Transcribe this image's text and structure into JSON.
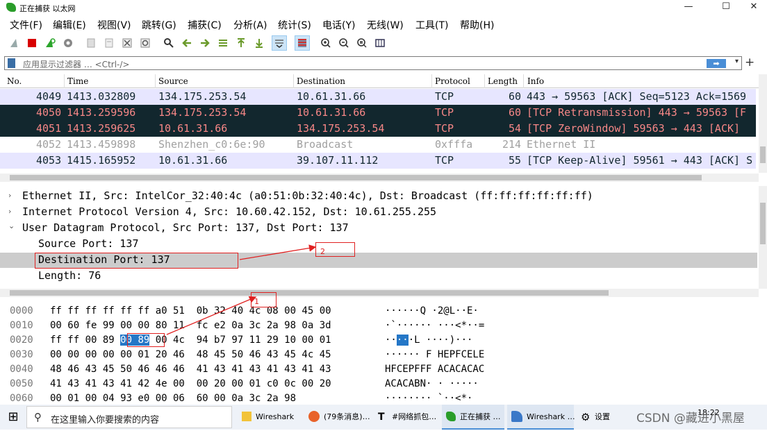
{
  "window": {
    "title": "正在捕获 以太网",
    "min": "—",
    "max": "☐",
    "close": "✕"
  },
  "menu": [
    "文件(F)",
    "编辑(E)",
    "视图(V)",
    "跳转(G)",
    "捕获(C)",
    "分析(A)",
    "统计(S)",
    "电话(Y)",
    "无线(W)",
    "工具(T)",
    "帮助(H)"
  ],
  "toolbar_icons": [
    "shark-fin-icon",
    "stop-icon",
    "restart-icon",
    "options-gear-icon",
    "open-icon",
    "save-icon",
    "close-file-icon",
    "reload-icon",
    "find-icon",
    "back-icon",
    "forward-icon",
    "goto-icon",
    "first-icon",
    "last-icon",
    "autoscroll-icon",
    "colorize-icon",
    "zoom-in-icon",
    "zoom-out-icon",
    "zoom-normal-icon",
    "resize-columns-icon"
  ],
  "filter": {
    "placeholder": "应用显示过滤器 … <Ctrl-/>",
    "apply_glyph": "➡",
    "dropdown_glyph": "▾",
    "add_glyph": "+"
  },
  "packet_list": {
    "columns": [
      "No.",
      "Time",
      "Source",
      "Destination",
      "Protocol",
      "Length",
      "Info"
    ],
    "rows": [
      {
        "no": "4049",
        "time": "1413.032809",
        "src": "134.175.253.54",
        "dst": "10.61.31.66",
        "proto": "TCP",
        "len": "60",
        "info": "443 → 59563 [ACK] Seq=5123 Ack=1569",
        "style": "tcp"
      },
      {
        "no": "4050",
        "time": "1413.259596",
        "src": "134.175.253.54",
        "dst": "10.61.31.66",
        "proto": "TCP",
        "len": "60",
        "info": "[TCP Retransmission] 443 → 59563 [F",
        "style": "bad"
      },
      {
        "no": "4051",
        "time": "1413.259625",
        "src": "10.61.31.66",
        "dst": "134.175.253.54",
        "proto": "TCP",
        "len": "54",
        "info": "[TCP ZeroWindow] 59563 → 443 [ACK] ",
        "style": "bad"
      },
      {
        "no": "4052",
        "time": "1413.459898",
        "src": "Shenzhen_c0:6e:90",
        "dst": "Broadcast",
        "proto": "0xfffa",
        "len": "214",
        "info": "Ethernet II",
        "style": "udp"
      },
      {
        "no": "4053",
        "time": "1415.165952",
        "src": "10.61.31.66",
        "dst": "39.107.11.112",
        "proto": "TCP",
        "len": "55",
        "info": "[TCP Keep-Alive] 59561 → 443 [ACK] S",
        "style": "tcp"
      }
    ]
  },
  "detail": {
    "lines": [
      {
        "arrow": "›",
        "text": "Ethernet II, Src: IntelCor_32:40:4c (a0:51:0b:32:40:4c), Dst: Broadcast (ff:ff:ff:ff:ff:ff)"
      },
      {
        "arrow": "›",
        "text": "Internet Protocol Version 4, Src: 10.60.42.152, Dst: 10.61.255.255"
      },
      {
        "arrow": "⌄",
        "text": "User Datagram Protocol, Src Port: 137, Dst Port: 137"
      }
    ],
    "sub": [
      "Source Port: 137",
      "Destination Port: 137",
      "Length: 76"
    ],
    "annotation_2": "2",
    "annotation_1": "1"
  },
  "bytes": {
    "offsets": [
      "0000",
      "0010",
      "0020",
      "0030",
      "0040",
      "0050",
      "0060"
    ],
    "hex": [
      "ff ff ff ff ff ff a0 51  0b 32 40 4c 08 00 45 00",
      "00 60 fe 99 00 00 80 11  fc e2 0a 3c 2a 98 0a 3d",
      "ff ff 00 89 00 89 00 4c  94 b7 97 11 29 10 00 01",
      "00 00 00 00 00 01 20 46  48 45 50 46 43 45 4c 45",
      "48 46 43 45 50 46 46 46  41 43 41 43 41 43 41 43",
      "41 43 41 43 41 42 4e 00  00 20 00 01 c0 0c 00 20",
      "00 01 00 04 93 e0 00 06  60 00 0a 3c 2a 98"
    ],
    "hex_sel_pre": "ff ff 00 89 ",
    "hex_sel": "00 89",
    "hex_sel_post": " 00 4c  94 b7 97 11 29 10 00 01",
    "ascii": [
      "······Q ·2@L··E·",
      "·`······ ···<*··=",
      "",
      "······ F HEPFCELE",
      "HFCEPFFF ACACACAC",
      "ACACABN· · ·····",
      "········ `··<*·"
    ],
    "ascii_sel_pre": "··",
    "ascii_sel": "··",
    "ascii_sel_post": "·L ····)···"
  },
  "taskbar": {
    "start_glyph": "⊞",
    "search_placeholder": "在这里输入你要搜索的内容",
    "search_glyph": "⚲",
    "items": [
      "Wireshark",
      "(79条消息)…",
      "#网络抓包…",
      "正在捕获 …",
      "Wireshark …",
      "设置"
    ],
    "clock": "18:22",
    "watermark": "CSDN @藏进小黑屋"
  }
}
